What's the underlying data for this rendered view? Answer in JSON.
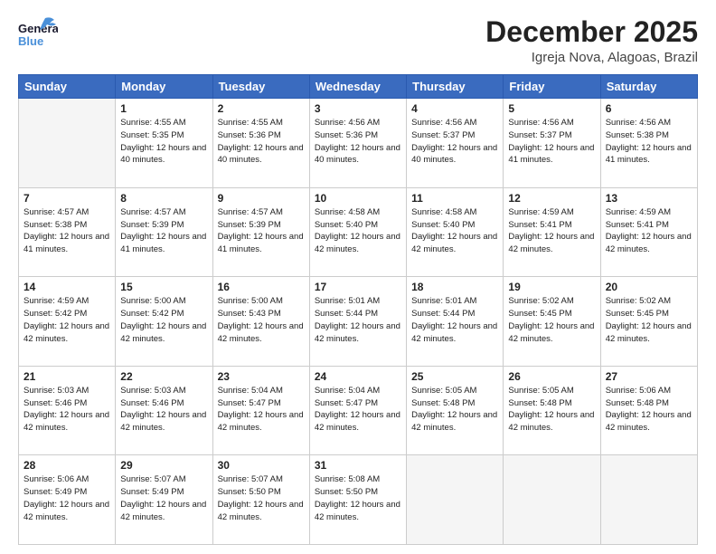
{
  "header": {
    "logo_top": "General",
    "logo_bottom": "Blue",
    "month_title": "December 2025",
    "location": "Igreja Nova, Alagoas, Brazil"
  },
  "days_of_week": [
    "Sunday",
    "Monday",
    "Tuesday",
    "Wednesday",
    "Thursday",
    "Friday",
    "Saturday"
  ],
  "weeks": [
    [
      {
        "day": "",
        "empty": true
      },
      {
        "day": "1",
        "sunrise": "Sunrise: 4:55 AM",
        "sunset": "Sunset: 5:35 PM",
        "daylight": "Daylight: 12 hours and 40 minutes."
      },
      {
        "day": "2",
        "sunrise": "Sunrise: 4:55 AM",
        "sunset": "Sunset: 5:36 PM",
        "daylight": "Daylight: 12 hours and 40 minutes."
      },
      {
        "day": "3",
        "sunrise": "Sunrise: 4:56 AM",
        "sunset": "Sunset: 5:36 PM",
        "daylight": "Daylight: 12 hours and 40 minutes."
      },
      {
        "day": "4",
        "sunrise": "Sunrise: 4:56 AM",
        "sunset": "Sunset: 5:37 PM",
        "daylight": "Daylight: 12 hours and 40 minutes."
      },
      {
        "day": "5",
        "sunrise": "Sunrise: 4:56 AM",
        "sunset": "Sunset: 5:37 PM",
        "daylight": "Daylight: 12 hours and 41 minutes."
      },
      {
        "day": "6",
        "sunrise": "Sunrise: 4:56 AM",
        "sunset": "Sunset: 5:38 PM",
        "daylight": "Daylight: 12 hours and 41 minutes."
      }
    ],
    [
      {
        "day": "7",
        "sunrise": "Sunrise: 4:57 AM",
        "sunset": "Sunset: 5:38 PM",
        "daylight": "Daylight: 12 hours and 41 minutes."
      },
      {
        "day": "8",
        "sunrise": "Sunrise: 4:57 AM",
        "sunset": "Sunset: 5:39 PM",
        "daylight": "Daylight: 12 hours and 41 minutes."
      },
      {
        "day": "9",
        "sunrise": "Sunrise: 4:57 AM",
        "sunset": "Sunset: 5:39 PM",
        "daylight": "Daylight: 12 hours and 41 minutes."
      },
      {
        "day": "10",
        "sunrise": "Sunrise: 4:58 AM",
        "sunset": "Sunset: 5:40 PM",
        "daylight": "Daylight: 12 hours and 42 minutes."
      },
      {
        "day": "11",
        "sunrise": "Sunrise: 4:58 AM",
        "sunset": "Sunset: 5:40 PM",
        "daylight": "Daylight: 12 hours and 42 minutes."
      },
      {
        "day": "12",
        "sunrise": "Sunrise: 4:59 AM",
        "sunset": "Sunset: 5:41 PM",
        "daylight": "Daylight: 12 hours and 42 minutes."
      },
      {
        "day": "13",
        "sunrise": "Sunrise: 4:59 AM",
        "sunset": "Sunset: 5:41 PM",
        "daylight": "Daylight: 12 hours and 42 minutes."
      }
    ],
    [
      {
        "day": "14",
        "sunrise": "Sunrise: 4:59 AM",
        "sunset": "Sunset: 5:42 PM",
        "daylight": "Daylight: 12 hours and 42 minutes."
      },
      {
        "day": "15",
        "sunrise": "Sunrise: 5:00 AM",
        "sunset": "Sunset: 5:42 PM",
        "daylight": "Daylight: 12 hours and 42 minutes."
      },
      {
        "day": "16",
        "sunrise": "Sunrise: 5:00 AM",
        "sunset": "Sunset: 5:43 PM",
        "daylight": "Daylight: 12 hours and 42 minutes."
      },
      {
        "day": "17",
        "sunrise": "Sunrise: 5:01 AM",
        "sunset": "Sunset: 5:44 PM",
        "daylight": "Daylight: 12 hours and 42 minutes."
      },
      {
        "day": "18",
        "sunrise": "Sunrise: 5:01 AM",
        "sunset": "Sunset: 5:44 PM",
        "daylight": "Daylight: 12 hours and 42 minutes."
      },
      {
        "day": "19",
        "sunrise": "Sunrise: 5:02 AM",
        "sunset": "Sunset: 5:45 PM",
        "daylight": "Daylight: 12 hours and 42 minutes."
      },
      {
        "day": "20",
        "sunrise": "Sunrise: 5:02 AM",
        "sunset": "Sunset: 5:45 PM",
        "daylight": "Daylight: 12 hours and 42 minutes."
      }
    ],
    [
      {
        "day": "21",
        "sunrise": "Sunrise: 5:03 AM",
        "sunset": "Sunset: 5:46 PM",
        "daylight": "Daylight: 12 hours and 42 minutes."
      },
      {
        "day": "22",
        "sunrise": "Sunrise: 5:03 AM",
        "sunset": "Sunset: 5:46 PM",
        "daylight": "Daylight: 12 hours and 42 minutes."
      },
      {
        "day": "23",
        "sunrise": "Sunrise: 5:04 AM",
        "sunset": "Sunset: 5:47 PM",
        "daylight": "Daylight: 12 hours and 42 minutes."
      },
      {
        "day": "24",
        "sunrise": "Sunrise: 5:04 AM",
        "sunset": "Sunset: 5:47 PM",
        "daylight": "Daylight: 12 hours and 42 minutes."
      },
      {
        "day": "25",
        "sunrise": "Sunrise: 5:05 AM",
        "sunset": "Sunset: 5:48 PM",
        "daylight": "Daylight: 12 hours and 42 minutes."
      },
      {
        "day": "26",
        "sunrise": "Sunrise: 5:05 AM",
        "sunset": "Sunset: 5:48 PM",
        "daylight": "Daylight: 12 hours and 42 minutes."
      },
      {
        "day": "27",
        "sunrise": "Sunrise: 5:06 AM",
        "sunset": "Sunset: 5:48 PM",
        "daylight": "Daylight: 12 hours and 42 minutes."
      }
    ],
    [
      {
        "day": "28",
        "sunrise": "Sunrise: 5:06 AM",
        "sunset": "Sunset: 5:49 PM",
        "daylight": "Daylight: 12 hours and 42 minutes."
      },
      {
        "day": "29",
        "sunrise": "Sunrise: 5:07 AM",
        "sunset": "Sunset: 5:49 PM",
        "daylight": "Daylight: 12 hours and 42 minutes."
      },
      {
        "day": "30",
        "sunrise": "Sunrise: 5:07 AM",
        "sunset": "Sunset: 5:50 PM",
        "daylight": "Daylight: 12 hours and 42 minutes."
      },
      {
        "day": "31",
        "sunrise": "Sunrise: 5:08 AM",
        "sunset": "Sunset: 5:50 PM",
        "daylight": "Daylight: 12 hours and 42 minutes."
      },
      {
        "day": "",
        "empty": true
      },
      {
        "day": "",
        "empty": true
      },
      {
        "day": "",
        "empty": true
      }
    ]
  ]
}
